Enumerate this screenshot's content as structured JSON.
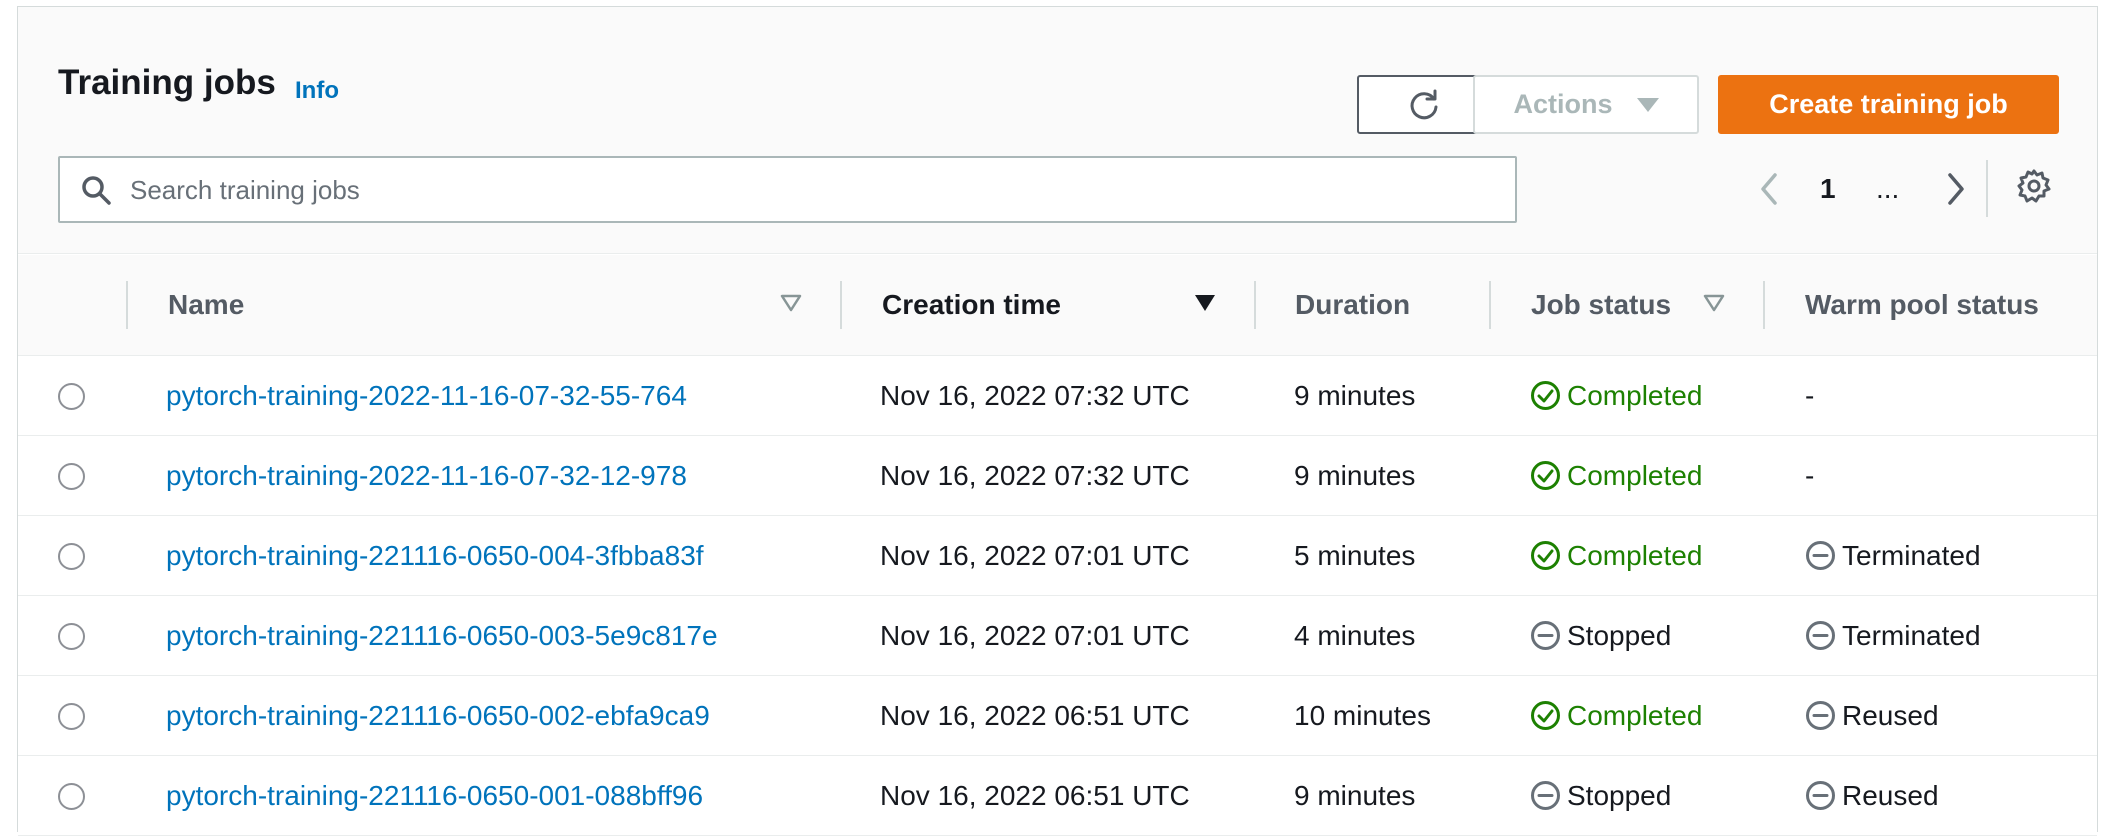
{
  "header": {
    "title": "Training jobs",
    "info_label": "Info",
    "actions_label": "Actions",
    "create_label": "Create training job"
  },
  "search": {
    "placeholder": "Search training jobs"
  },
  "pagination": {
    "current_page": "1",
    "ellipsis": "..."
  },
  "columns": [
    "Name",
    "Creation time",
    "Duration",
    "Job status",
    "Warm pool status"
  ],
  "colors": {
    "accent_link": "#0073bb",
    "primary_button": "#ec7211",
    "status_success": "#1d8102",
    "status_neutral": "#687078"
  },
  "icons": [
    "refresh-icon",
    "caret-down-icon",
    "search-icon",
    "chevron-left-icon",
    "chevron-right-icon",
    "settings-icon",
    "filter-icon",
    "sort-descending-icon",
    "status-success-icon",
    "status-stopped-icon"
  ],
  "rows": [
    {
      "name": "pytorch-training-2022-11-16-07-32-55-764",
      "created": "Nov 16, 2022 07:32 UTC",
      "duration": "9 minutes",
      "job_status": "Completed",
      "job_kind": "success",
      "warm_pool": "-",
      "warm_kind": "none"
    },
    {
      "name": "pytorch-training-2022-11-16-07-32-12-978",
      "created": "Nov 16, 2022 07:32 UTC",
      "duration": "9 minutes",
      "job_status": "Completed",
      "job_kind": "success",
      "warm_pool": "-",
      "warm_kind": "none"
    },
    {
      "name": "pytorch-training-221116-0650-004-3fbba83f",
      "created": "Nov 16, 2022 07:01 UTC",
      "duration": "5 minutes",
      "job_status": "Completed",
      "job_kind": "success",
      "warm_pool": "Terminated",
      "warm_kind": "stopped"
    },
    {
      "name": "pytorch-training-221116-0650-003-5e9c817e",
      "created": "Nov 16, 2022 07:01 UTC",
      "duration": "4 minutes",
      "job_status": "Stopped",
      "job_kind": "stopped",
      "warm_pool": "Terminated",
      "warm_kind": "stopped"
    },
    {
      "name": "pytorch-training-221116-0650-002-ebfa9ca9",
      "created": "Nov 16, 2022 06:51 UTC",
      "duration": "10 minutes",
      "job_status": "Completed",
      "job_kind": "success",
      "warm_pool": "Reused",
      "warm_kind": "stopped"
    },
    {
      "name": "pytorch-training-221116-0650-001-088bff96",
      "created": "Nov 16, 2022 06:51 UTC",
      "duration": "9 minutes",
      "job_status": "Stopped",
      "job_kind": "stopped",
      "warm_pool": "Reused",
      "warm_kind": "stopped"
    }
  ]
}
